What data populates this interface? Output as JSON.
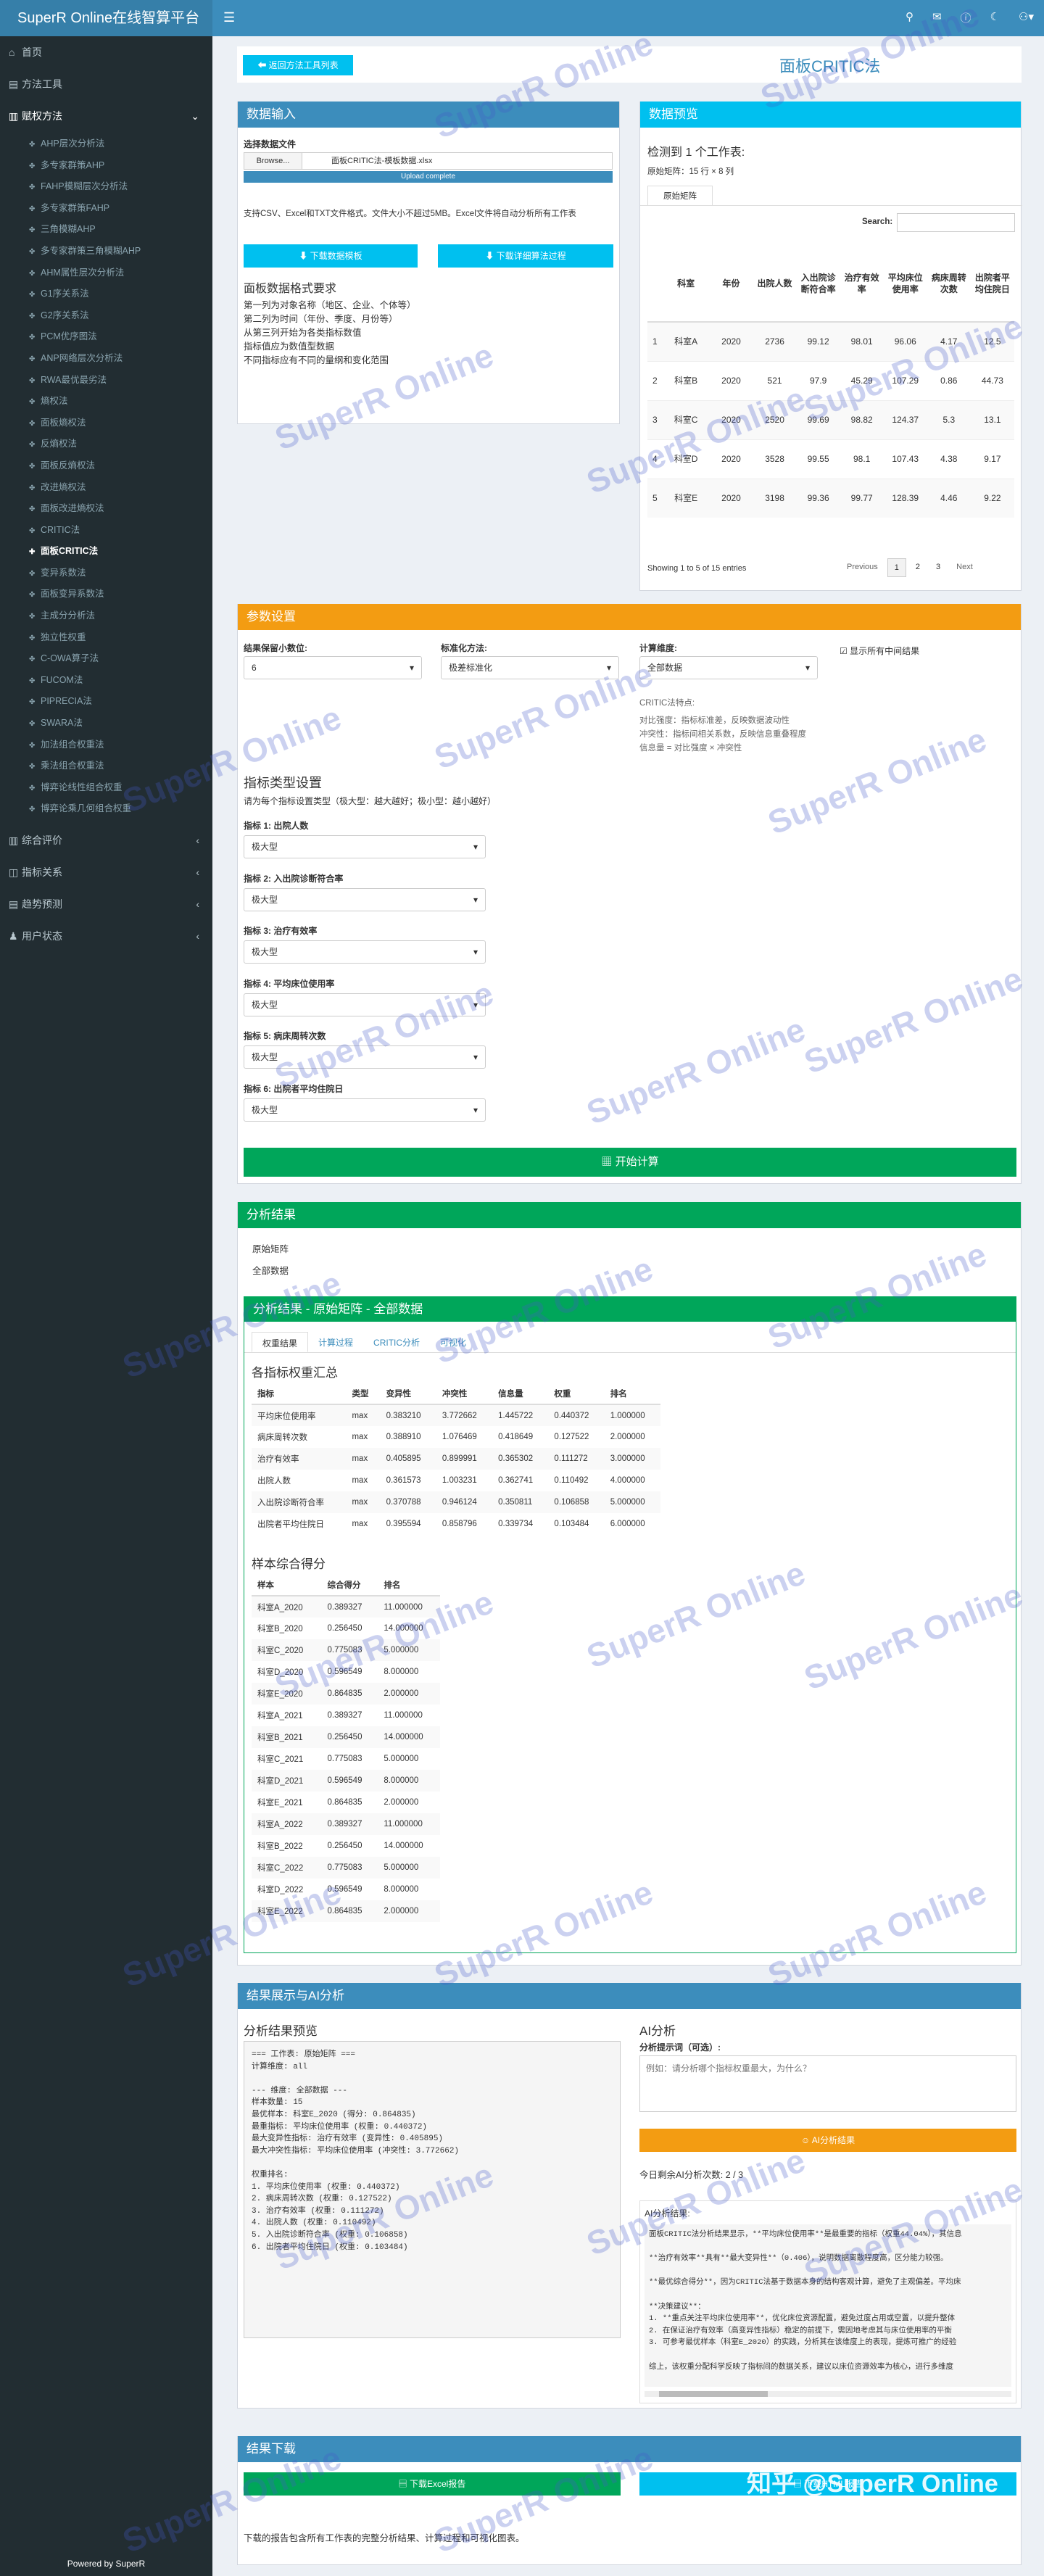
{
  "app": {
    "title": "SuperR Online在线智算平台"
  },
  "sidebar": {
    "top": [
      {
        "label": "首页",
        "icon": "home-icon"
      },
      {
        "label": "方法工具",
        "icon": "tools-icon"
      },
      {
        "label": "赋权方法",
        "icon": "folder-icon"
      }
    ],
    "items": [
      "AHP层次分析法",
      "多专家群策AHP",
      "FAHP模糊层次分析法",
      "多专家群策FAHP",
      "三角模糊AHP",
      "多专家群策三角模糊AHP",
      "AHM属性层次分析法",
      "G1序关系法",
      "G2序关系法",
      "PCM优序图法",
      "ANP网络层次分析法",
      "RWA最优最劣法",
      "熵权法",
      "面板熵权法",
      "反熵权法",
      "面板反熵权法",
      "改进熵权法",
      "面板改进熵权法",
      "CRITIC法",
      "面板CRITIC法",
      "变异系数法",
      "面板变异系数法",
      "主成分分析法",
      "独立性权重",
      "C-OWA算子法",
      "FUCOM法",
      "PIPRECIA法",
      "SWARA法",
      "加法组合权重法",
      "乘法组合权重法",
      "博弈论线性组合权重",
      "博弈论乘几何组合权重"
    ],
    "active_index": 19,
    "bottom": [
      {
        "label": "综合评价",
        "icon": "chart-icon"
      },
      {
        "label": "指标关系",
        "icon": "relation-icon"
      },
      {
        "label": "趋势预测",
        "icon": "trend-icon"
      },
      {
        "label": "用户状态",
        "icon": "user-icon"
      }
    ],
    "footer": "Powered by SuperR"
  },
  "page": {
    "back_button": "返回方法工具列表",
    "title": "面板CRITIC法"
  },
  "input": {
    "header": "数据输入",
    "file_label": "选择数据文件",
    "browse": "Browse...",
    "filename": "面板CRITIC法-模板数据.xlsx",
    "upload_status": "Upload complete",
    "note": "支持CSV、Excel和TXT文件格式。文件大小不超过5MB。Excel文件将自动分析所有工作表",
    "download_template": "下载数据模板",
    "download_guide": "下载详细算法过程",
    "format_title": "面板数据格式要求",
    "format_lines": [
      "第一列为对象名称（地区、企业、个体等）",
      "第二列为时间（年份、季度、月份等）",
      "从第三列开始为各类指标数值",
      "指标值应为数值型数据",
      "不同指标应有不同的量纲和变化范围"
    ]
  },
  "preview": {
    "header": "数据预览",
    "detected": "检测到 1 个工作表:",
    "size": "原始矩阵：15 行 × 8 列",
    "tab": "原始矩阵",
    "search_label": "Search:",
    "columns": [
      "",
      "科室",
      "年份",
      "出院人数",
      "入出院诊断符合率",
      "治疗有效率",
      "平均床位使用率",
      "病床周转次数",
      "出院者平均住院日"
    ],
    "rows": [
      [
        "1",
        "科室A",
        "2020",
        "2736",
        "99.12",
        "98.01",
        "96.06",
        "4.17",
        "12.5"
      ],
      [
        "2",
        "科室B",
        "2020",
        "521",
        "97.9",
        "45.29",
        "107.29",
        "0.86",
        "44.73"
      ],
      [
        "3",
        "科室C",
        "2020",
        "2520",
        "99.69",
        "98.82",
        "124.37",
        "5.3",
        "13.1"
      ],
      [
        "4",
        "科室D",
        "2020",
        "3528",
        "99.55",
        "98.1",
        "107.43",
        "4.38",
        "9.17"
      ],
      [
        "5",
        "科室E",
        "2020",
        "3198",
        "99.36",
        "99.77",
        "128.39",
        "4.46",
        "9.22"
      ]
    ],
    "info": "Showing 1 to 5 of 15 entries",
    "pagination": [
      "Previous",
      "1",
      "2",
      "3",
      "Next"
    ]
  },
  "params": {
    "header": "参数设置",
    "decimals_label": "结果保留小数位:",
    "decimals_value": "6",
    "standard_label": "标准化方法:",
    "standard_value": "极差标准化",
    "dimension_label": "计算维度:",
    "dimension_value": "全部数据",
    "show_steps": "显示所有中间结果",
    "critic_title": "CRITIC法特点:",
    "critic_lines": [
      "对比强度：指标标准差，反映数据波动性",
      "冲突性：指标间相关系数，反映信息重叠程度",
      "信息量 = 对比强度 × 冲突性"
    ],
    "type_title": "指标类型设置",
    "type_hint": "请为每个指标设置类型（极大型：越大越好；极小型：越小越好）",
    "indicators": [
      {
        "label": "指标 1: 出院人数",
        "value": "极大型"
      },
      {
        "label": "指标 2: 入出院诊断符合率",
        "value": "极大型"
      },
      {
        "label": "指标 3: 治疗有效率",
        "value": "极大型"
      },
      {
        "label": "指标 4: 平均床位使用率",
        "value": "极大型"
      },
      {
        "label": "指标 5: 病床周转次数",
        "value": "极大型"
      },
      {
        "label": "指标 6: 出院者平均住院日",
        "value": "极大型"
      }
    ],
    "calc_button": "开始计算"
  },
  "results": {
    "header": "分析结果",
    "nav": [
      "原始矩阵",
      "全部数据"
    ],
    "sub_header": "分析结果 - 原始矩阵 - 全部数据",
    "tabs": [
      "权重结果",
      "计算过程",
      "CRITIC分析",
      "可视化"
    ],
    "weight_title": "各指标权重汇总",
    "weight_columns": [
      "指标",
      "类型",
      "变异性",
      "冲突性",
      "信息量",
      "权重",
      "排名"
    ],
    "weight_rows": [
      [
        "平均床位使用率",
        "max",
        "0.383210",
        "3.772662",
        "1.445722",
        "0.440372",
        "1.000000"
      ],
      [
        "病床周转次数",
        "max",
        "0.388910",
        "1.076469",
        "0.418649",
        "0.127522",
        "2.000000"
      ],
      [
        "治疗有效率",
        "max",
        "0.405895",
        "0.899991",
        "0.365302",
        "0.111272",
        "3.000000"
      ],
      [
        "出院人数",
        "max",
        "0.361573",
        "1.003231",
        "0.362741",
        "0.110492",
        "4.000000"
      ],
      [
        "入出院诊断符合率",
        "max",
        "0.370788",
        "0.946124",
        "0.350811",
        "0.106858",
        "5.000000"
      ],
      [
        "出院者平均住院日",
        "max",
        "0.395594",
        "0.858796",
        "0.339734",
        "0.103484",
        "6.000000"
      ]
    ],
    "score_title": "样本综合得分",
    "score_columns": [
      "样本",
      "综合得分",
      "排名"
    ],
    "score_rows": [
      [
        "科室A_2020",
        "0.389327",
        "11.000000"
      ],
      [
        "科室B_2020",
        "0.256450",
        "14.000000"
      ],
      [
        "科室C_2020",
        "0.775083",
        "5.000000"
      ],
      [
        "科室D_2020",
        "0.596549",
        "8.000000"
      ],
      [
        "科室E_2020",
        "0.864835",
        "2.000000"
      ],
      [
        "科室A_2021",
        "0.389327",
        "11.000000"
      ],
      [
        "科室B_2021",
        "0.256450",
        "14.000000"
      ],
      [
        "科室C_2021",
        "0.775083",
        "5.000000"
      ],
      [
        "科室D_2021",
        "0.596549",
        "8.000000"
      ],
      [
        "科室E_2021",
        "0.864835",
        "2.000000"
      ],
      [
        "科室A_2022",
        "0.389327",
        "11.000000"
      ],
      [
        "科室B_2022",
        "0.256450",
        "14.000000"
      ],
      [
        "科室C_2022",
        "0.775083",
        "5.000000"
      ],
      [
        "科室D_2022",
        "0.596549",
        "8.000000"
      ],
      [
        "科室E_2022",
        "0.864835",
        "2.000000"
      ]
    ]
  },
  "ai": {
    "header": "结果展示与AI分析",
    "preview_title": "分析结果预览",
    "preview_text": "=== 工作表: 原始矩阵 ===\n计算维度: all\n\n--- 维度: 全部数据 ---\n样本数量: 15\n最优样本: 科室E_2020 (得分: 0.864835)\n最重指标: 平均床位使用率 (权重: 0.440372)\n最大变异性指标: 治疗有效率 (变异性: 0.405895)\n最大冲突性指标: 平均床位使用率 (冲突性: 3.772662)\n\n权重排名:\n1. 平均床位使用率 (权重: 0.440372)\n2. 病床周转次数 (权重: 0.127522)\n3. 治疗有效率 (权重: 0.111272)\n4. 出院人数 (权重: 0.110492)\n5. 入出院诊断符合率 (权重: 0.106858)\n6. 出院者平均住院日 (权重: 0.103484)",
    "ai_title": "AI分析",
    "prompt_label": "分析提示词（可选）:",
    "prompt_placeholder": "例如：请分析哪个指标权重最大，为什么？",
    "ai_button": "AI分析结果",
    "remaining": "今日剩余AI分析次数: 2 / 3",
    "result_label": "AI分析结果:",
    "result_text": "面板CRITIC法分析结果显示，**平均床位使用率**是最重要的指标（权重44.04%），其信息\n\n**治疗有效率**具有**最大变异性**（0.406），说明数据离散程度高，区分能力较强。\n\n**最优综合得分**，因为CRITIC法基于数据本身的结构客观计算，避免了主观偏差。平均床\n\n**决策建议**：\n1. **重点关注平均床位使用率**，优化床位资源配置，避免过度占用或空置，以提升整体\n2. 在保证治疗有效率（高变异性指标）稳定的前提下，需因地考虑其与床位使用率的平衡\n3. 可参考最优样本（科室E_2020）的实践，分析其在该维度上的表现，提炼可推广的经验\n\n综上，该权重分配科学反映了指标间的数据关系，建议以床位资源效率为核心，进行多维度"
  },
  "download": {
    "header": "结果下载",
    "excel": "下载Excel报告",
    "html": "下载HTML报告",
    "note": "下载的报告包含所有工作表的完整分析结果、计算过程和可视化图表。"
  },
  "watermark": {
    "text": "SuperR Online",
    "zhihu": "知乎 @SuperR Online"
  }
}
